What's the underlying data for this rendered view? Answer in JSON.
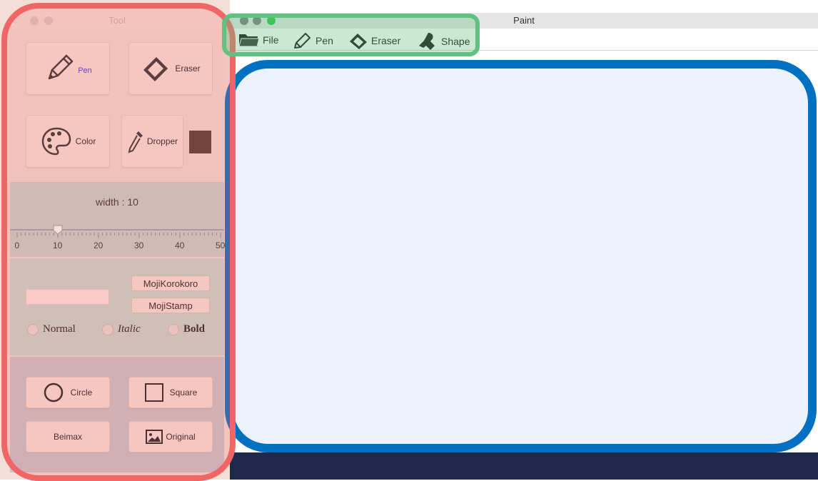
{
  "tool_window": {
    "title": "Tool",
    "buttons": {
      "pen": "Pen",
      "eraser": "Eraser",
      "color": "Color",
      "dropper": "Dropper",
      "circle": "Circle",
      "square": "Square",
      "beimax": "Beimax",
      "original": "Original"
    },
    "current_color": "#4f3a2f",
    "width_label": "width : 10",
    "width_value": 10,
    "slider_min": 0,
    "slider_max": 50,
    "slider_ticks": [
      "0",
      "10",
      "20",
      "30",
      "40",
      "50"
    ],
    "moji": {
      "korokoro": "MojiKorokoro",
      "stamp": "MojiStamp",
      "input_value": ""
    },
    "font_styles": {
      "normal": "Normal",
      "italic": "Italic",
      "bold": "Bold"
    }
  },
  "paint_window": {
    "title": "Paint",
    "menu": {
      "file": "File",
      "pen": "Pen",
      "eraser": "Eraser",
      "shape": "Shape"
    }
  },
  "colors": {
    "highlight_red": "#f06666",
    "highlight_green": "#63c083",
    "highlight_blue": "#0070c2",
    "pen_label_accent": "#3b3bd6"
  },
  "icons": {
    "pen": "pencil-icon",
    "eraser": "eraser-icon",
    "color": "palette-icon",
    "dropper": "dropper-icon",
    "circle": "circle-outline-icon",
    "square": "square-outline-icon",
    "original": "image-icon",
    "file": "folder-icon",
    "shape": "stamp-icon"
  }
}
